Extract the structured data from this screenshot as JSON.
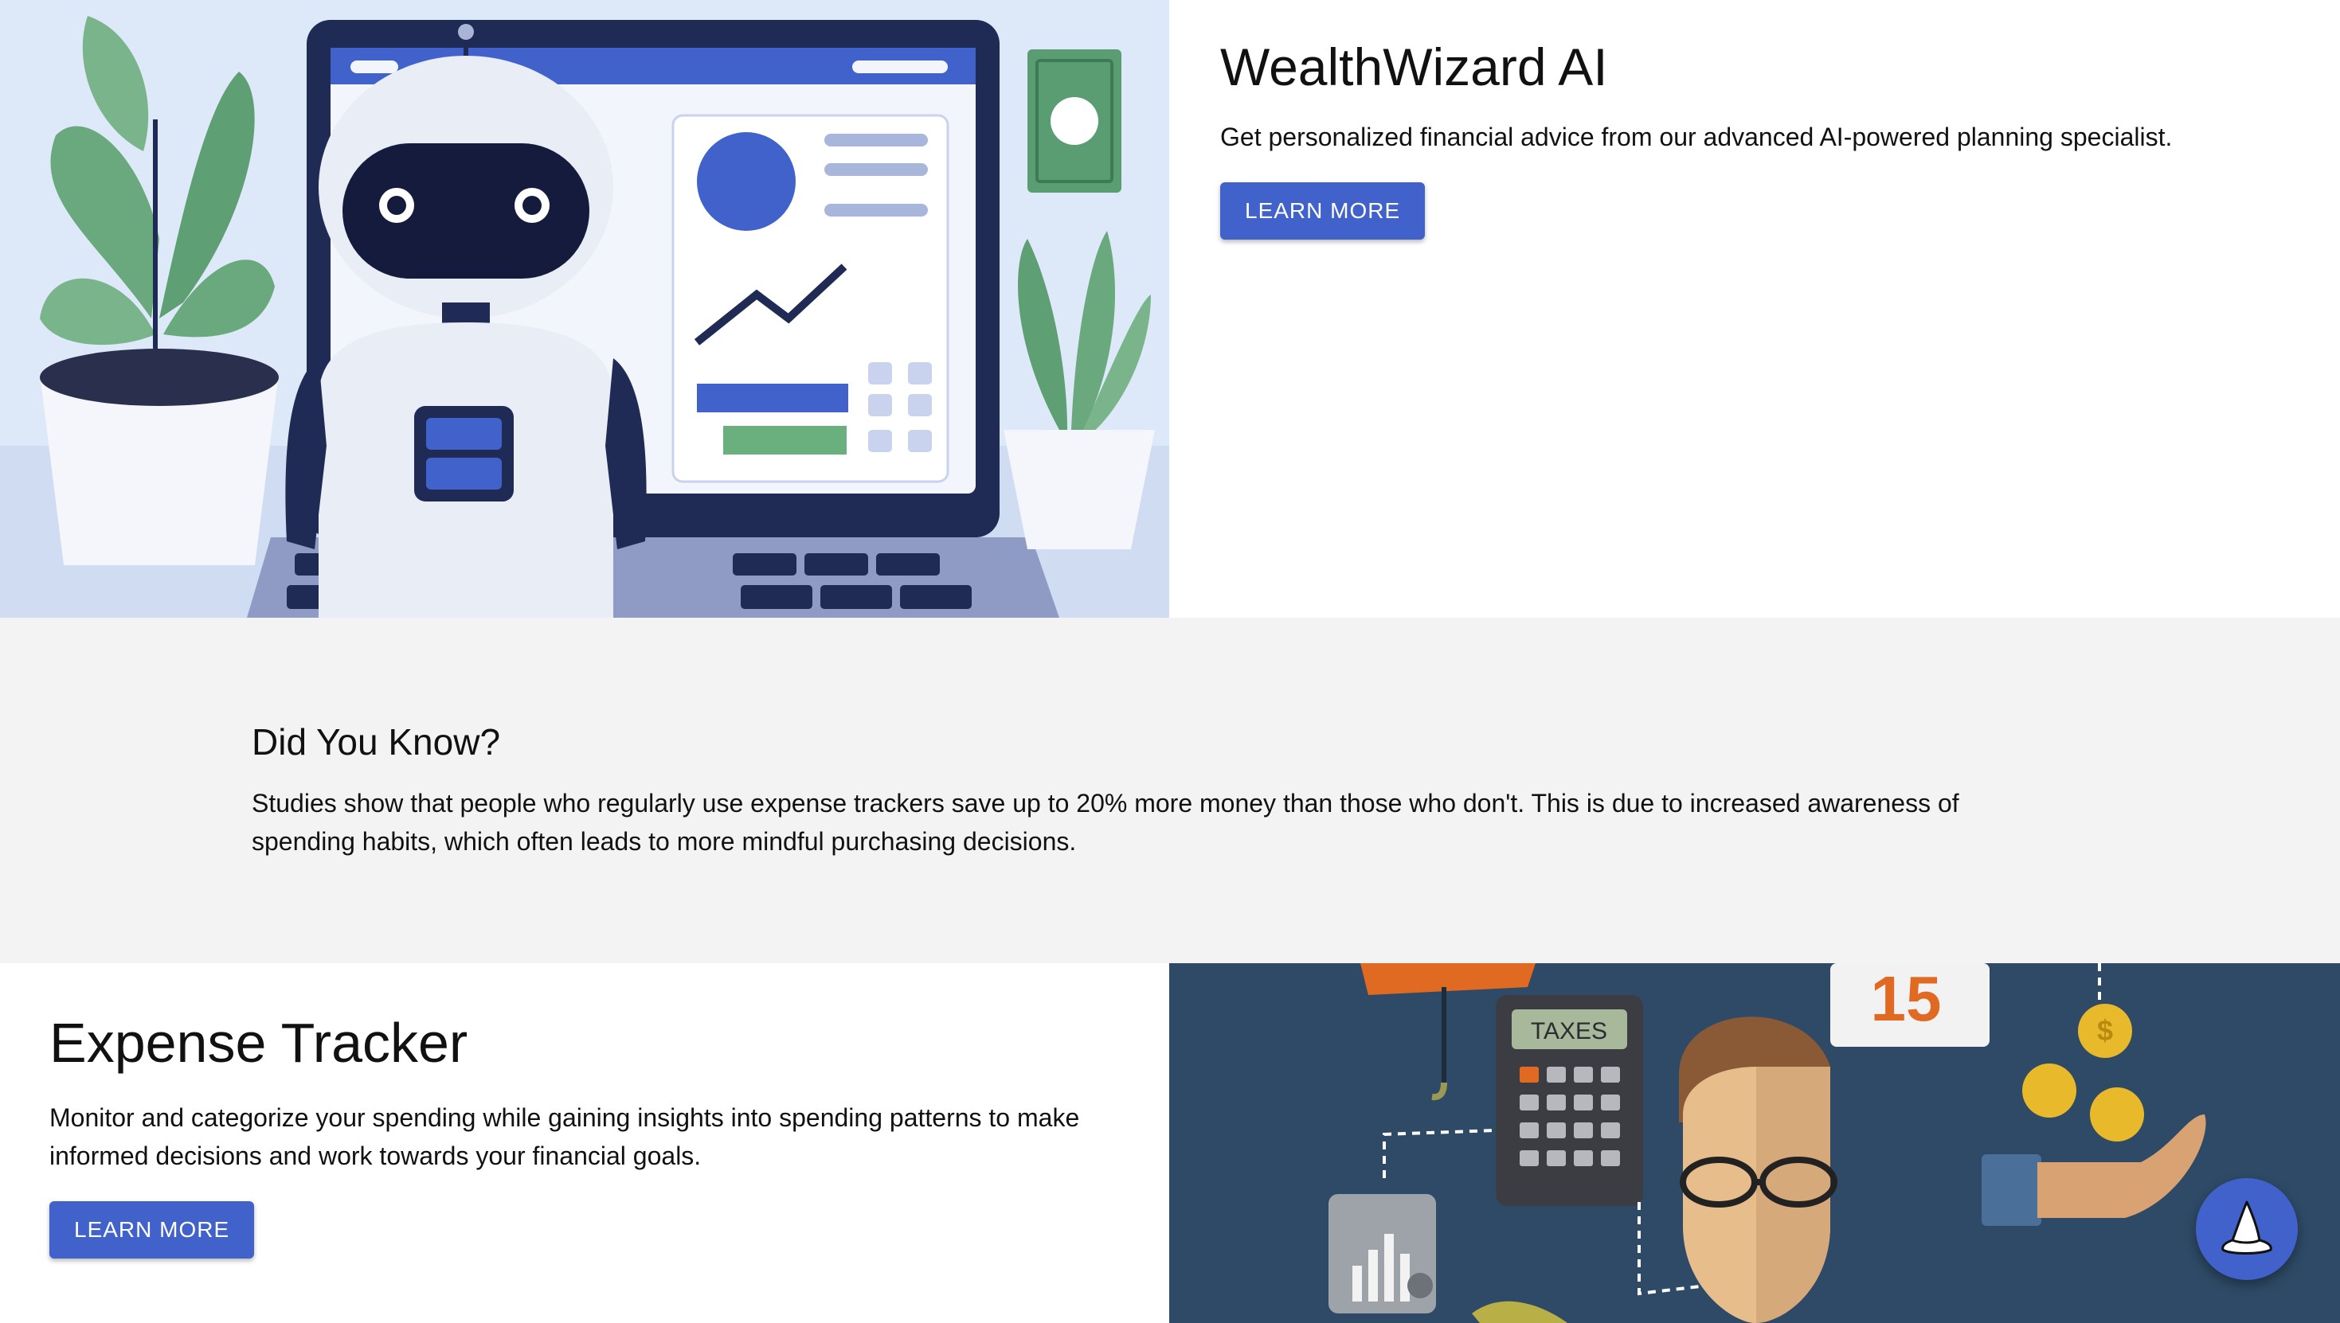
{
  "wealth": {
    "title": "WealthWizard AI",
    "description": "Get personalized financial advice from our advanced AI-powered planning specialist.",
    "button_label": "LEARN MORE"
  },
  "fact": {
    "heading": "Did You Know?",
    "body": "Studies show that people who regularly use expense trackers save up to 20% more money than those who don't. This is due to increased awareness of spending habits, which often leads to more mindful purchasing decisions."
  },
  "expense": {
    "title": "Expense Tracker",
    "description": "Monitor and categorize your spending while gaining insights into spending patterns to make informed decisions and work towards your financial goals.",
    "button_label": "LEARN MORE"
  },
  "illustration": {
    "calculator_label": "TAXES",
    "calendar_day": "15",
    "coin_symbol": "$"
  },
  "fab": {
    "icon": "wizard-hat-icon"
  },
  "colors": {
    "accent": "#4262cb",
    "fact_bg": "#f3f3f3",
    "illustration_bg": "#2e4a66"
  }
}
